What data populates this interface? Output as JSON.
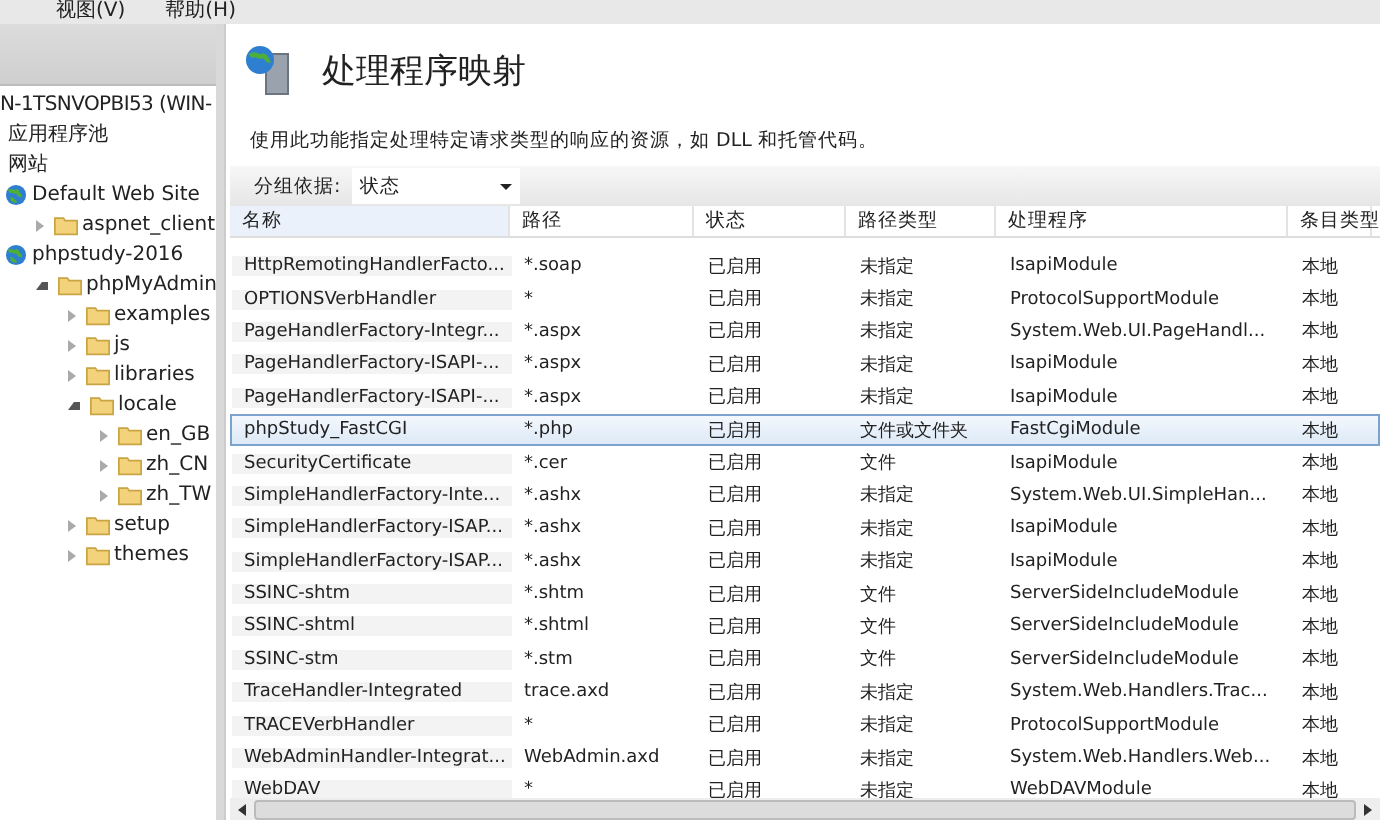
{
  "menu": [
    "视图(V)",
    "帮助(H)"
  ],
  "tree": {
    "server": "N-1TSNVOPBI53 (WIN-",
    "items": [
      {
        "label": "应用程序池",
        "kind": "plain"
      },
      {
        "label": "网站",
        "kind": "plain"
      },
      {
        "label": "Default Web Site",
        "kind": "globe",
        "children": [
          {
            "label": "aspnet_client",
            "kind": "folder",
            "expanded": false
          }
        ]
      },
      {
        "label": "phpstudy-2016",
        "kind": "globe",
        "children": [
          {
            "label": "phpMyAdmin",
            "kind": "folder",
            "expanded": true,
            "children": [
              {
                "label": "examples",
                "kind": "folder",
                "expanded": false
              },
              {
                "label": "js",
                "kind": "folder",
                "expanded": false
              },
              {
                "label": "libraries",
                "kind": "folder",
                "expanded": false
              },
              {
                "label": "locale",
                "kind": "folder",
                "expanded": true,
                "children": [
                  {
                    "label": "en_GB",
                    "kind": "folder",
                    "expanded": false
                  },
                  {
                    "label": "zh_CN",
                    "kind": "folder",
                    "expanded": false
                  },
                  {
                    "label": "zh_TW",
                    "kind": "folder",
                    "expanded": false
                  }
                ]
              },
              {
                "label": "setup",
                "kind": "folder",
                "expanded": false
              },
              {
                "label": "themes",
                "kind": "folder",
                "expanded": false
              }
            ]
          }
        ]
      }
    ]
  },
  "page": {
    "title": "处理程序映射",
    "description": "使用此功能指定处理特定请求类型的响应的资源，如 DLL 和托管代码。",
    "group_label": "分组依据:",
    "group_value": "状态"
  },
  "table": {
    "columns": [
      "名称",
      "路径",
      "状态",
      "路径类型",
      "处理程序",
      "条目类型"
    ],
    "rows": [
      {
        "cells": [
          "HttpRemotingHandlerFacto...",
          "*.soap",
          "已启用",
          "未指定",
          "IsapiModule",
          "本地"
        ],
        "selected": false
      },
      {
        "cells": [
          "OPTIONSVerbHandler",
          "*",
          "已启用",
          "未指定",
          "ProtocolSupportModule",
          "本地"
        ],
        "selected": false
      },
      {
        "cells": [
          "PageHandlerFactory-Integr...",
          "*.aspx",
          "已启用",
          "未指定",
          "System.Web.UI.PageHandl...",
          "本地"
        ],
        "selected": false
      },
      {
        "cells": [
          "PageHandlerFactory-ISAPI-...",
          "*.aspx",
          "已启用",
          "未指定",
          "IsapiModule",
          "本地"
        ],
        "selected": false
      },
      {
        "cells": [
          "PageHandlerFactory-ISAPI-...",
          "*.aspx",
          "已启用",
          "未指定",
          "IsapiModule",
          "本地"
        ],
        "selected": false
      },
      {
        "cells": [
          "phpStudy_FastCGI",
          "*.php",
          "已启用",
          "文件或文件夹",
          "FastCgiModule",
          "本地"
        ],
        "selected": true
      },
      {
        "cells": [
          "SecurityCertificate",
          "*.cer",
          "已启用",
          "文件",
          "IsapiModule",
          "本地"
        ],
        "selected": false
      },
      {
        "cells": [
          "SimpleHandlerFactory-Inte...",
          "*.ashx",
          "已启用",
          "未指定",
          "System.Web.UI.SimpleHan...",
          "本地"
        ],
        "selected": false
      },
      {
        "cells": [
          "SimpleHandlerFactory-ISAP...",
          "*.ashx",
          "已启用",
          "未指定",
          "IsapiModule",
          "本地"
        ],
        "selected": false
      },
      {
        "cells": [
          "SimpleHandlerFactory-ISAP...",
          "*.ashx",
          "已启用",
          "未指定",
          "IsapiModule",
          "本地"
        ],
        "selected": false
      },
      {
        "cells": [
          "SSINC-shtm",
          "*.shtm",
          "已启用",
          "文件",
          "ServerSideIncludeModule",
          "本地"
        ],
        "selected": false
      },
      {
        "cells": [
          "SSINC-shtml",
          "*.shtml",
          "已启用",
          "文件",
          "ServerSideIncludeModule",
          "本地"
        ],
        "selected": false
      },
      {
        "cells": [
          "SSINC-stm",
          "*.stm",
          "已启用",
          "文件",
          "ServerSideIncludeModule",
          "本地"
        ],
        "selected": false
      },
      {
        "cells": [
          "TraceHandler-Integrated",
          "trace.axd",
          "已启用",
          "未指定",
          "System.Web.Handlers.Trac...",
          "本地"
        ],
        "selected": false
      },
      {
        "cells": [
          "TRACEVerbHandler",
          "*",
          "已启用",
          "未指定",
          "ProtocolSupportModule",
          "本地"
        ],
        "selected": false
      },
      {
        "cells": [
          "WebAdminHandler-Integrat...",
          "WebAdmin.axd",
          "已启用",
          "未指定",
          "System.Web.Handlers.Web...",
          "本地"
        ],
        "selected": false
      },
      {
        "cells": [
          "WebDAV",
          "*",
          "已启用",
          "未指定",
          "WebDAVModule",
          "本地"
        ],
        "selected": false
      }
    ]
  }
}
